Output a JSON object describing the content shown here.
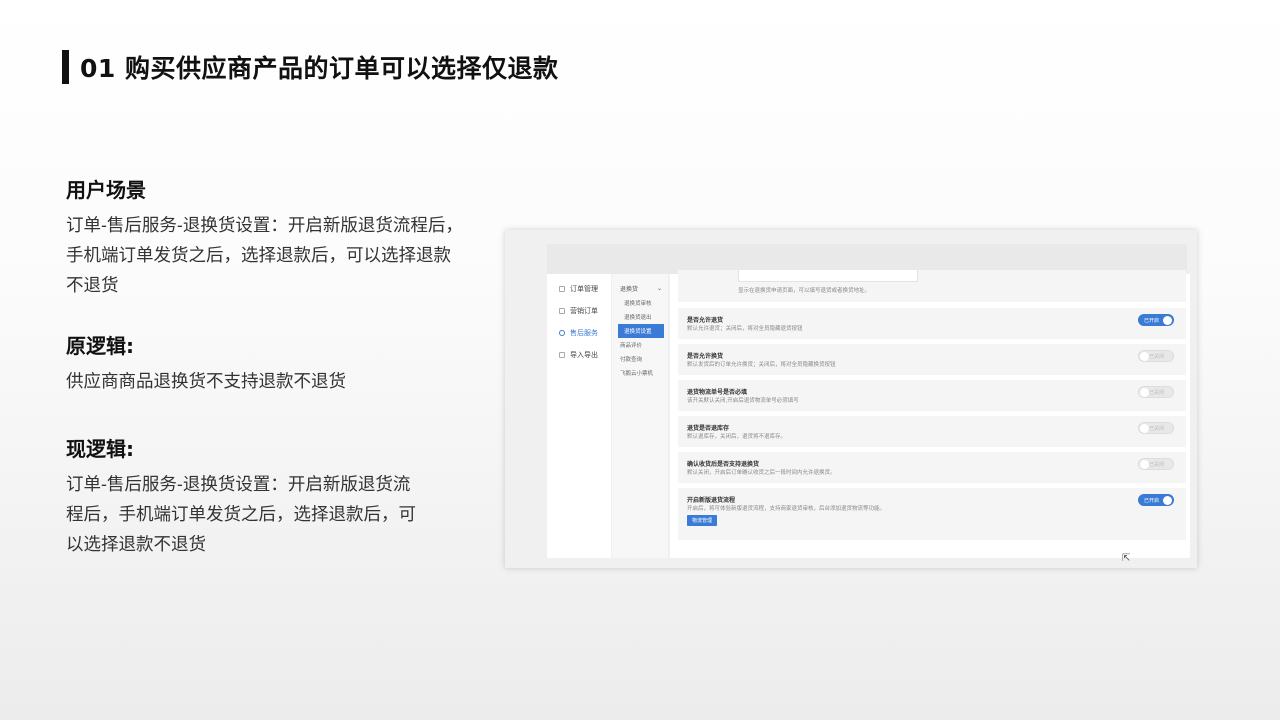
{
  "page": {
    "title": "01 购买供应商产品的订单可以选择仅退款"
  },
  "sections": [
    {
      "heading": "用户场景",
      "body": "订单-售后服务-退换货设置：开启新版退货流程后，手机端订单发货之后，选择退款后，可以选择退款不退货"
    },
    {
      "heading": "原逻辑:",
      "body": "供应商商品退换货不支持退款不退货"
    },
    {
      "heading": "现逻辑:",
      "body": "订单-售后服务-退换货设置：开启新版退货流程后，手机端订单发货之后，选择退款后，可以选择退款不退货"
    }
  ],
  "screenshot": {
    "nav_primary": [
      {
        "label": "订单管理",
        "active": false
      },
      {
        "label": "营销订单",
        "active": false
      },
      {
        "label": "售后服务",
        "active": true
      },
      {
        "label": "导入导出",
        "active": false
      }
    ],
    "nav_secondary": {
      "group": "退换货",
      "items": [
        "退换货审核",
        "退换货退出",
        "退换货设置"
      ],
      "active": "退换货设置",
      "others": [
        "商品评价",
        "付款查询",
        "飞鹅云小票机"
      ]
    },
    "top_hint": "显示在退换货申请页面，可以填写退货或者换货地址。",
    "settings": [
      {
        "title": "是否允许退货",
        "desc": "默认允许退货；关闭后，将对全员隐藏退货按钮",
        "on": true,
        "toggle_label": "已开启"
      },
      {
        "title": "是否允许换货",
        "desc": "默认发货后的订单允许换货；关闭后，将对全员隐藏换货按钮",
        "on": false,
        "toggle_label": "已关闭"
      },
      {
        "title": "退货物流单号是否必填",
        "desc": "该开关默认关闭,开启后退货物流单号必须填写",
        "on": false,
        "toggle_label": "已关闭"
      },
      {
        "title": "退货是否退库存",
        "desc": "默认退库存，关闭后，退货将不退库存。",
        "on": false,
        "toggle_label": "已关闭"
      },
      {
        "title": "确认收货后是否支持退换货",
        "desc": "默认关闭，开启后订单确认收货之后一段时间内允许退换货。",
        "on": false,
        "toggle_label": "已关闭"
      },
      {
        "title": "开启新版退货流程",
        "desc": "开启后，将可体验新版退货流程，支持商家退货审核，后台添加退货物流等功能。",
        "on": true,
        "toggle_label": "已开启",
        "button": "物流管理"
      }
    ]
  }
}
